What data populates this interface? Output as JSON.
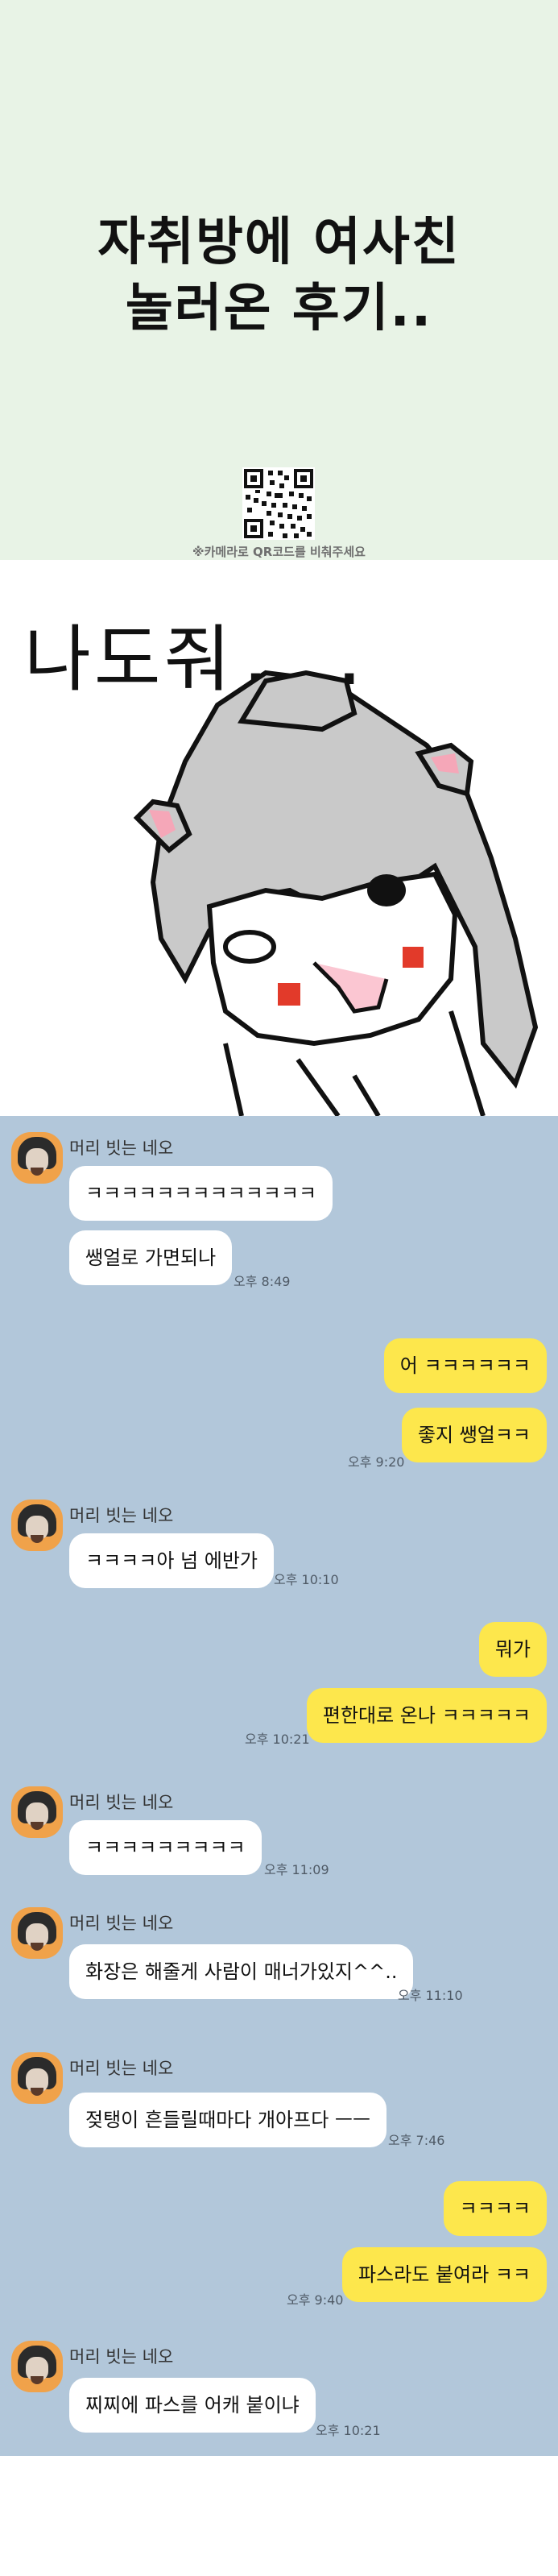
{
  "header": {
    "title_line1": "자취방에 여사친",
    "title_line2": "놀러온 후기..",
    "qr_caption": "※카메라로 QR코드를 비춰주세요"
  },
  "illustration": {
    "text": "나도줘..."
  },
  "chat": {
    "sender_name": "머리 빗는 네오",
    "messages": [
      {
        "text": "ㅋㅋㅋㅋㅋㅋㅋㅋㅋㅋㅋㅋㅋ"
      },
      {
        "text": "쌩얼로 가면되나",
        "time": "오후 8:49"
      },
      {
        "text": "어 ㅋㅋㅋㅋㅋㅋ"
      },
      {
        "text": "좋지 쌩얼ㅋㅋ",
        "time": "오후 9:20"
      },
      {
        "text": "ㅋㅋㅋㅋ아 넘 에반가",
        "time": "오후 10:10"
      },
      {
        "text": "뭐가"
      },
      {
        "text": "편한대로 온나 ㅋㅋㅋㅋㅋ",
        "time": "오후 10:21"
      },
      {
        "text": "ㅋㅋㅋㅋㅋㅋㅋㅋㅋ",
        "time": "오후 11:09"
      },
      {
        "text": "화장은 해줄게 사람이 매너가있지^^..",
        "time": "오후 11:10"
      },
      {
        "text": "젖탱이 흔들릴때마다 개아프다 ㅡㅡ",
        "time": "오후 7:46"
      },
      {
        "text": "ㅋㅋㅋㅋ"
      },
      {
        "text": "파스라도 붙여라 ㅋㅋ",
        "time": "오후 9:40"
      },
      {
        "text": "찌찌에 파스를 어캐 붙이냐",
        "time": "오후 10:21"
      }
    ]
  },
  "colors": {
    "header_bg": "#e8f3e6",
    "chat_bg": "#b2c7da",
    "incoming_bubble": "#ffffff",
    "outgoing_bubble": "#fde74c",
    "avatar_bg": "#f0a24a"
  }
}
